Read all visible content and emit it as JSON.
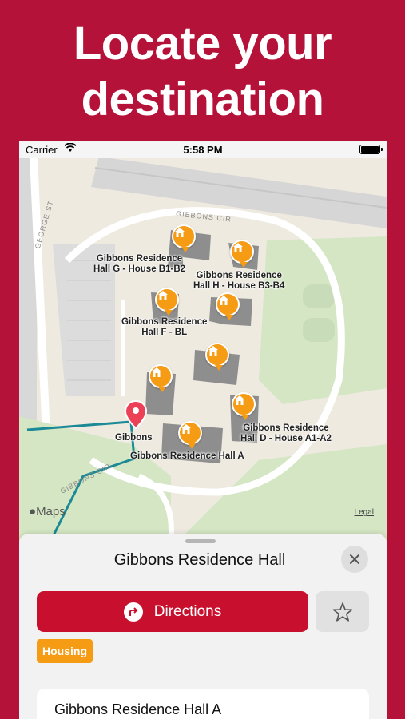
{
  "headline": {
    "line1": "Locate your",
    "line2": "destination"
  },
  "status_bar": {
    "carrier": "Carrier",
    "time": "5:58 PM"
  },
  "map": {
    "streets": {
      "george_st": "GEORGE ST",
      "gibbons_cir_top": "GIBBONS CIR",
      "gibbons_cir_bottom": "GIBBONS CIR"
    },
    "labels": {
      "hall_g_line1": "Gibbons Residence",
      "hall_g_line2": "Hall G - House B1-B2",
      "hall_h_line1": "Gibbons Residence",
      "hall_h_line2": "Hall H - House B3-B4",
      "hall_f_line1": "Gibbons Residence",
      "hall_f_line2": "Hall F - BL",
      "hall_d_line1": "Gibbons Residence",
      "hall_d_line2": "Hall D - House A1-A2",
      "hall_a": "Gibbons Residence Hall A",
      "gibbons": "Gibbons"
    },
    "logo": "Maps",
    "legal": "Legal",
    "pin_icon": "house-icon",
    "pin_color": "#f59b14",
    "route_color": "#1c8a96"
  },
  "sheet": {
    "title": "Gibbons Residence Hall",
    "directions_label": "Directions",
    "category_tag": "Housing",
    "first_item": "Gibbons Residence Hall A"
  },
  "colors": {
    "brand": "#b5123a",
    "button": "#c8102e",
    "tag": "#f59b14"
  }
}
